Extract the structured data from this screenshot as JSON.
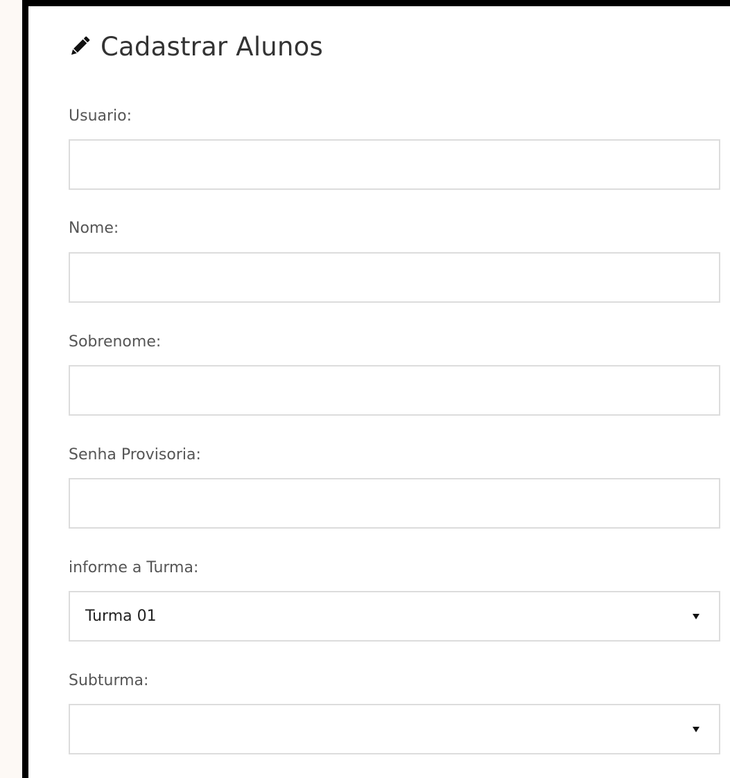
{
  "form": {
    "title": "Cadastrar Alunos",
    "title_icon": "pencil-icon",
    "fields": {
      "usuario": {
        "label": "Usuario:",
        "value": "",
        "placeholder": ""
      },
      "nome": {
        "label": "Nome:",
        "value": "",
        "placeholder": ""
      },
      "sobrenome": {
        "label": "Sobrenome:",
        "value": "",
        "placeholder": ""
      },
      "senha": {
        "label": "Senha Provisoria:",
        "value": "",
        "placeholder": ""
      }
    },
    "turma": {
      "label": "informe a Turma:",
      "selected": "Turma 01"
    },
    "subturma": {
      "label": "Subturma:",
      "selected": ""
    }
  },
  "colors": {
    "background": "#fdf9f5",
    "panel": "#ffffff",
    "border": "#000000",
    "input_border": "#dcdcdc"
  }
}
